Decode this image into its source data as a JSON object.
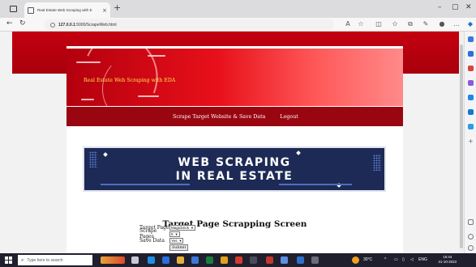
{
  "browser": {
    "tab_title": "Real Estate Web Scraping with E",
    "tab_close": "×",
    "new_tab": "+",
    "url_host": "127.0.0.1",
    "url_rest": ":5000/ScrapeWeb.html",
    "window_min": "–",
    "window_max": "▢",
    "window_close": "✕"
  },
  "site": {
    "brand": "Real Estate Web Scraping with EDA",
    "nav": [
      {
        "label": "Scrape Target Website & Save Data"
      },
      {
        "label": "Logout"
      }
    ],
    "hero_line1": "WEB SCRAPING",
    "hero_line2": "IN REAL ESTATE"
  },
  "main": {
    "heading": "Target Page Scrapping Screen",
    "fields": {
      "target_page_label": "Target Page",
      "target_page_value": "Magicbrick",
      "scrape_pages_label": "Scrape Pages",
      "scrape_pages_value": "5",
      "save_data_label": "Save Data",
      "save_data_value": "Yes"
    },
    "submit_label": "Submit"
  },
  "taskbar": {
    "search_placeholder": "Type here to search",
    "weather": "30°C",
    "lang": "ENG",
    "time": "15:44",
    "date": "31-10-2023"
  }
}
